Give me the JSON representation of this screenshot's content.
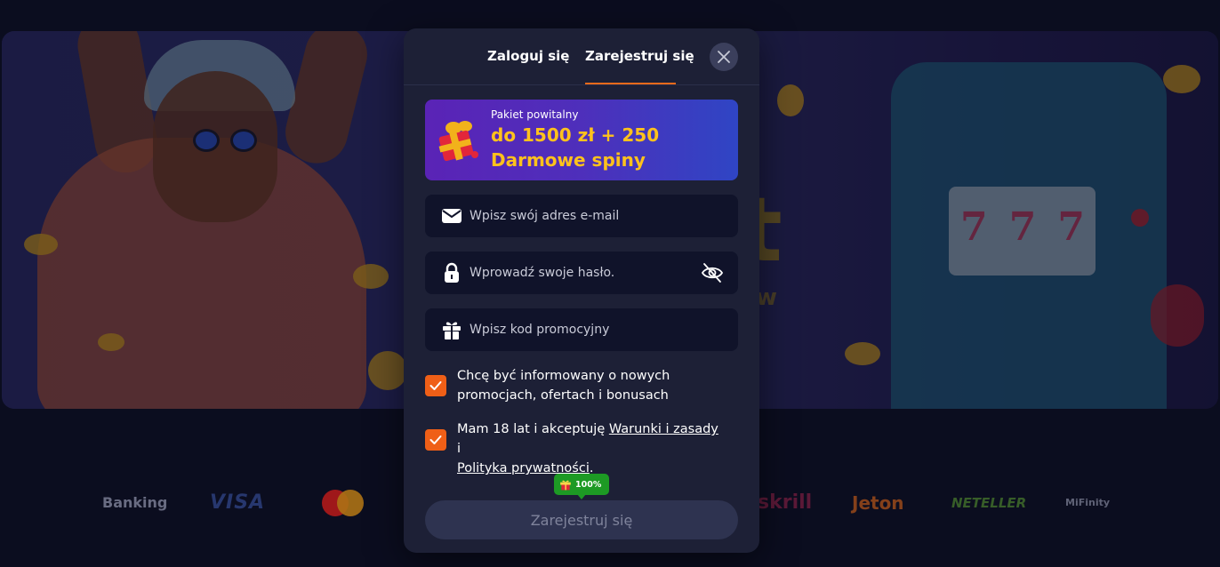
{
  "modal": {
    "tabs": [
      {
        "label": "Zaloguj się",
        "active": false
      },
      {
        "label": "Zarejestruj się",
        "active": true
      }
    ],
    "close_icon": "close-icon",
    "promo": {
      "title": "Pakiet powitalny",
      "line1": "do 1500 zł + 250",
      "line2": "Darmowe spiny",
      "icon": "gift-box-icon"
    },
    "fields": {
      "email": {
        "placeholder": "Wpisz swój adres e-mail",
        "value": "",
        "icon": "mail-icon"
      },
      "password": {
        "placeholder": "Wprowadź swoje hasło.",
        "value": "",
        "icon": "lock-icon",
        "toggle_icon": "eye-off-icon"
      },
      "promo_code": {
        "placeholder": "Wpisz kod promocyjny",
        "value": "",
        "icon": "gift-icon"
      }
    },
    "consent": {
      "newsletter": {
        "text": "Chcę być informowany o nowych promocjach, ofertach i bonusach",
        "checked": true
      },
      "terms": {
        "prefix": "Mam 18 lat i akceptuję ",
        "terms_link": "Warunki i zasady",
        "middle": " i",
        "privacy_link": "Polityka prywatności",
        "suffix": ".",
        "checked": true
      }
    },
    "badge": {
      "text": "100%",
      "icon": "gift-icon"
    },
    "submit_label": "Zarejestruj się"
  },
  "payments": {
    "banking": "Banking",
    "visa": "VISA",
    "skrill": "skrill",
    "jeton": "Jeton",
    "neteller": "NETELLER",
    "mifinity": "MiFinity"
  },
  "colors": {
    "accent": "#ef6a1b",
    "promo_gold": "#ffc21c",
    "badge_green": "#1d9a24",
    "modal_bg": "#1d2036",
    "field_bg": "#10132a"
  }
}
